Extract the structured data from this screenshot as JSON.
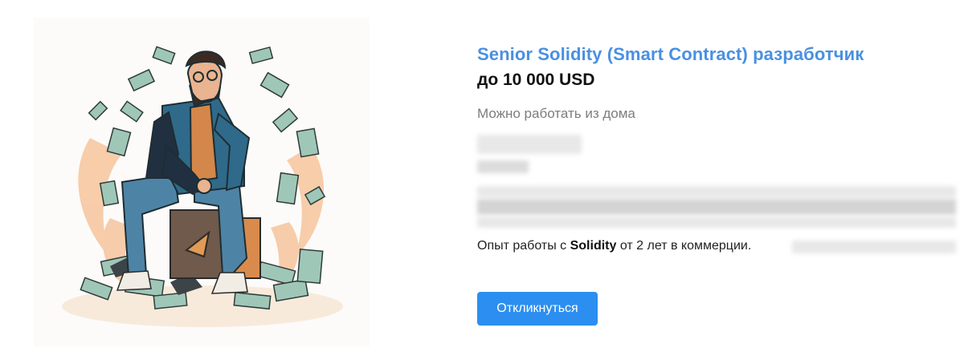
{
  "vacancy": {
    "title": "Senior Solidity (Smart Contract) разработчик",
    "salary": "до 10 000 USD",
    "work_format": "Можно работать из дома",
    "requirement_prefix": "Опыт работы с ",
    "requirement_skill": "Solidity",
    "requirement_suffix": " от 2 лет в коммерции.",
    "respond_label": "Откликнуться"
  },
  "colors": {
    "title": "#4a90e2",
    "button": "#2b8ef0",
    "muted_text": "#7d7d7d"
  },
  "illustration": {
    "subject": "bearded-man-in-suit-sitting-on-box-surrounded-by-money-icon"
  }
}
